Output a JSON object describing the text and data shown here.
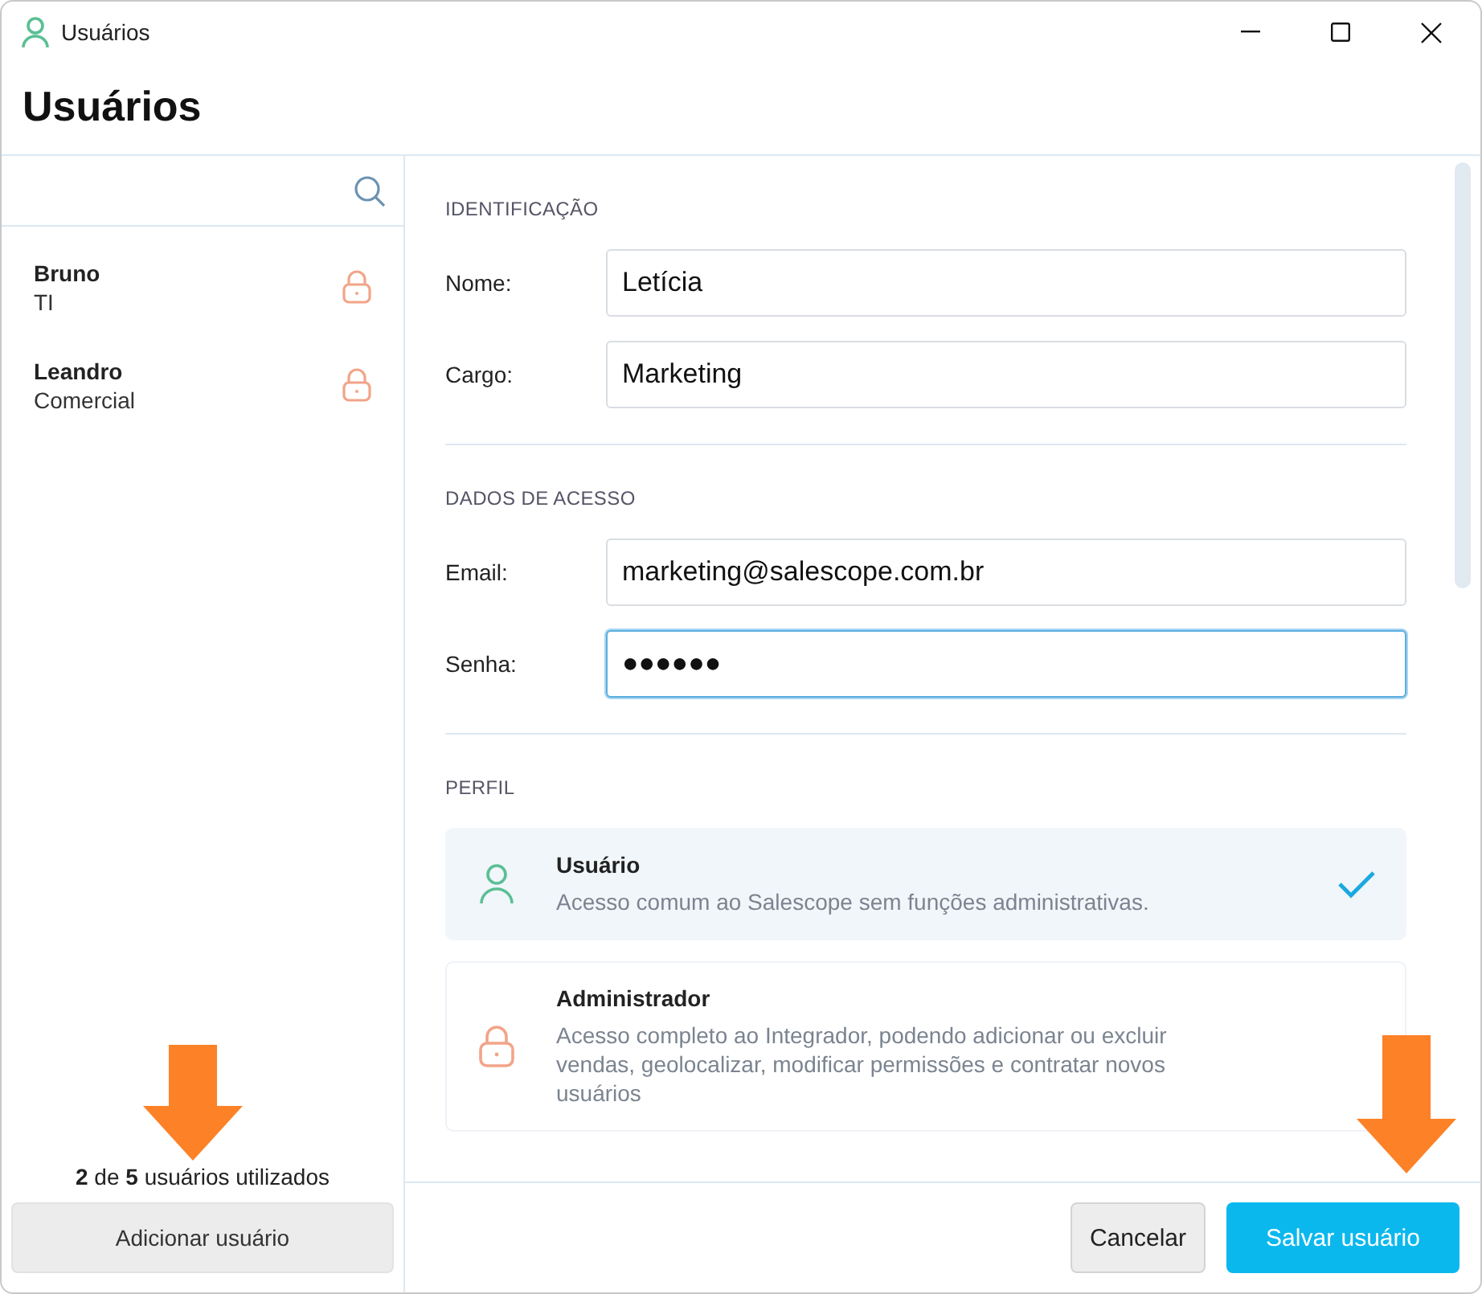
{
  "window": {
    "title": "Usuários"
  },
  "heading": "Usuários",
  "sidebar": {
    "users": [
      {
        "name": "Bruno",
        "role": "TI",
        "locked": true
      },
      {
        "name": "Leandro",
        "role": "Comercial",
        "locked": true
      }
    ],
    "usage": "**2** de **5** usuários utilizados",
    "add_button": "Adicionar usuário"
  },
  "sections": [
    {
      "title": "IDENTIFICAÇÃO",
      "fields": [
        {
          "label": "Nome:",
          "value": "Letícia",
          "focused": false
        },
        {
          "label": "Cargo:",
          "value": "Marketing",
          "focused": false
        }
      ]
    },
    {
      "title": "DADOS DE ACESSO",
      "fields": [
        {
          "label": "Email:",
          "value": "marketing@salescope.com.br",
          "focused": false
        },
        {
          "label": "Senha:",
          "value": "●●●●●●",
          "focused": true
        }
      ]
    }
  ],
  "profile": {
    "title": "PERFIL",
    "options": [
      {
        "kind": "user",
        "name": "Usuário",
        "description": "Acesso comum ao Salescope sem funções administrativas.",
        "selected": true
      },
      {
        "kind": "locked",
        "name": "Administrador",
        "description": "Acesso completo ao Integrador, podendo adicionar ou excluir vendas, geolocalizar, modificar permissões e contratar novos usuários",
        "selected": false
      }
    ]
  },
  "footer": {
    "buttons": [
      {
        "label": "Cancelar",
        "kind": "secondary"
      },
      {
        "label": "Salvar usuário",
        "kind": "primary"
      }
    ]
  }
}
